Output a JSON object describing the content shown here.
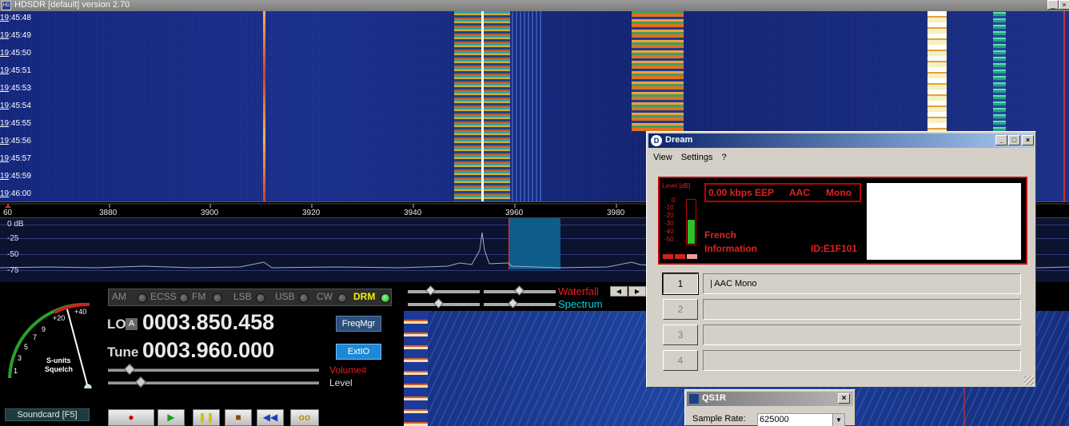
{
  "app": {
    "title": "HDSDR [default]  version 2.70",
    "icon_label": "HD"
  },
  "waterfall": {
    "timestamps": [
      {
        "hh": "19",
        "rest": ":45:48"
      },
      {
        "hh": "19",
        "rest": ":45:49"
      },
      {
        "hh": "19",
        "rest": ":45:50"
      },
      {
        "hh": "19",
        "rest": ":45:51"
      },
      {
        "hh": "19",
        "rest": ":45:53"
      },
      {
        "hh": "19",
        "rest": ":45:54"
      },
      {
        "hh": "19",
        "rest": ":45:55"
      },
      {
        "hh": "19",
        "rest": ":45:56"
      },
      {
        "hh": "19",
        "rest": ":45:57"
      },
      {
        "hh": "19",
        "rest": ":45:59"
      },
      {
        "hh": "19",
        "rest": ":46:00"
      }
    ]
  },
  "scale": {
    "ticks": [
      "60",
      "3880",
      "3900",
      "3920",
      "3940",
      "3960",
      "3980"
    ]
  },
  "spectrum": {
    "db_labels": [
      "0 dB",
      "-25",
      "-50",
      "-75"
    ]
  },
  "smeter": {
    "labels": [
      "+40",
      "+20",
      "9",
      "7",
      "5",
      "3",
      "1"
    ],
    "title1": "S-units",
    "title2": "Squelch"
  },
  "soundcard": "Soundcard  [F5]",
  "modes": [
    {
      "label": "AM",
      "active": false
    },
    {
      "label": "ECSS",
      "active": false
    },
    {
      "label": "FM",
      "active": false
    },
    {
      "label": "LSB",
      "active": false
    },
    {
      "label": "USB",
      "active": false
    },
    {
      "label": "CW",
      "active": false
    },
    {
      "label": "DRM",
      "active": true
    }
  ],
  "lo": {
    "label": "LO",
    "badge": "A",
    "value": "0003.850.458"
  },
  "tune": {
    "label": "Tune",
    "value": "0003.960.000"
  },
  "buttons": {
    "freqmgr": "FreqMgr",
    "extio": "ExtIO"
  },
  "volume": {
    "volume_label": "Volume#",
    "level_label": "Level"
  },
  "transport": [
    "●",
    "▶",
    "❚❚",
    "■",
    "◀◀",
    "oo"
  ],
  "wf_controls": {
    "waterfall_label": "Waterfall",
    "spectrum_label": "Spectrum"
  },
  "dream": {
    "title": "Dream",
    "menu": [
      "View",
      "Settings",
      "?"
    ],
    "level_label": "Level [dB]",
    "level_ticks": [
      "0",
      "-10",
      "-20",
      "-30",
      "-40",
      "-50"
    ],
    "status_rate": "0.00 kbps EEP",
    "status_codec": "AAC",
    "status_audio": "Mono",
    "language": "French",
    "program_type": "Information",
    "id": "ID:E1F101",
    "services": [
      {
        "num": "1",
        "label": "|  AAC Mono",
        "selected": true
      },
      {
        "num": "2",
        "label": "",
        "selected": false
      },
      {
        "num": "3",
        "label": "",
        "selected": false
      },
      {
        "num": "4",
        "label": "",
        "selected": false
      }
    ]
  },
  "qs1r": {
    "title": "QS1R",
    "sample_rate_label": "Sample Rate:",
    "sample_rate_value": "625000"
  },
  "colors": {
    "waterfall_bg": "#1a2f8c",
    "drm_active": "#f2f200",
    "dream_accent": "#c00000",
    "dream_title": "#0a246a",
    "volume_red": "#e02020",
    "spectrum_cyan": "#00d0e0"
  }
}
